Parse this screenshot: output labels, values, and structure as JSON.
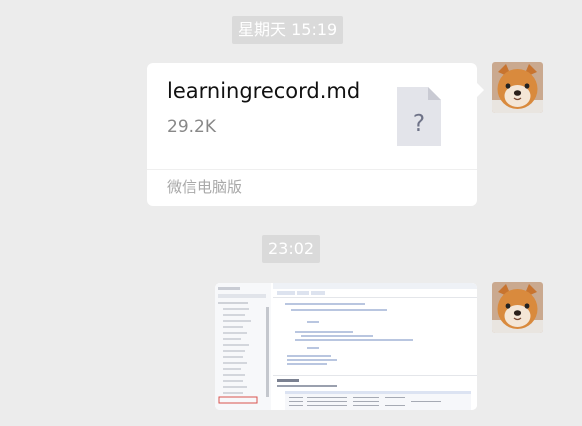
{
  "messages": [
    {
      "timestamp": "星期天 15:19",
      "file": {
        "name": "learningrecord.md",
        "size": "29.2K",
        "source": "微信电脑版",
        "icon_glyph": "?",
        "icon": "unknown-file-icon"
      }
    },
    {
      "timestamp": "23:02",
      "image": {
        "icon": "screenshot-thumbnail"
      }
    }
  ],
  "colors": {
    "background": "#ececec",
    "bubble": "#ffffff",
    "timestamp_bg": "#dadada",
    "file_icon": "#e3e4ea",
    "highlight": "#d9534f"
  }
}
